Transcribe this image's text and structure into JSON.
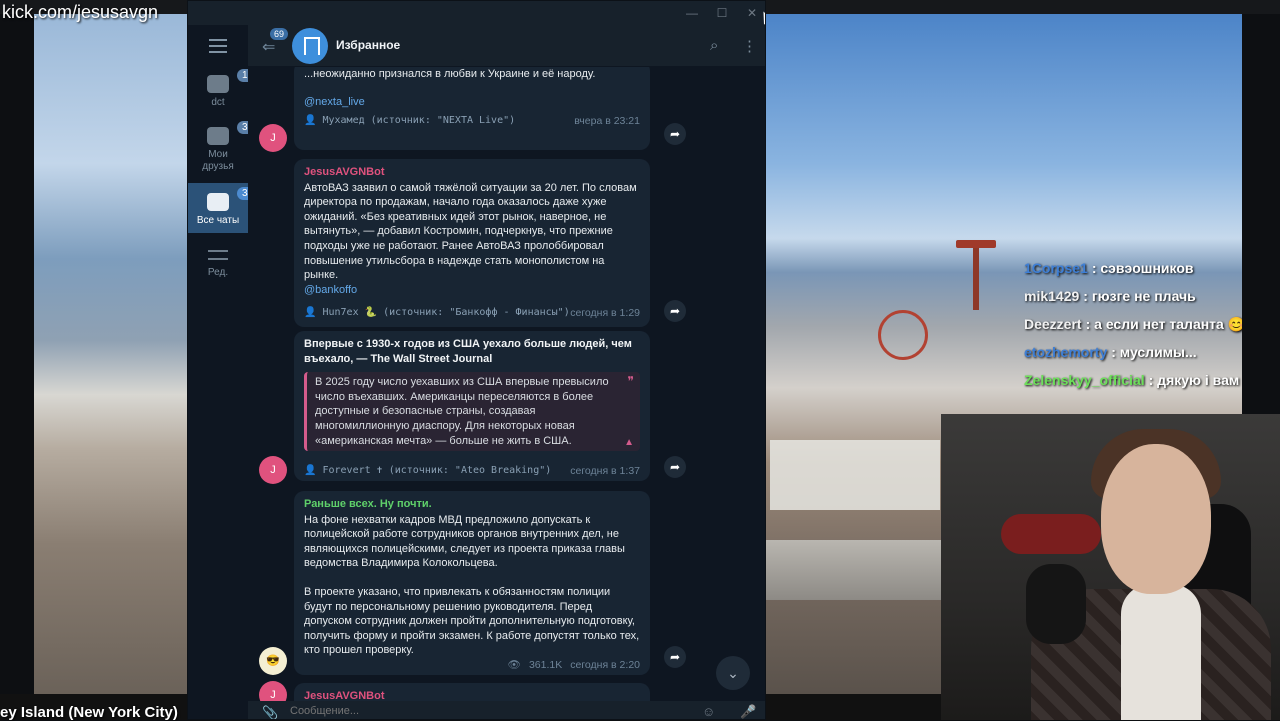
{
  "stream": {
    "url": "kick.com/jesusavgn",
    "location_caption": "ey Island (New York City)"
  },
  "stream_chat": [
    {
      "nick": "1Corpse1",
      "text": ": сэвэошников",
      "color": "#3e7fd6"
    },
    {
      "nick": "mik1429",
      "text": ": гюзге не плачь",
      "color": "#f2f2f2"
    },
    {
      "nick": "Deezzert",
      "text": ": а если нет таланта 😊",
      "color": "#f2f2f2"
    },
    {
      "nick": "etozhemorty",
      "text": ": муслимы...",
      "color": "#3e7fd6"
    },
    {
      "nick": "Zelenskyy_official",
      "text": ": дякую і вам",
      "color": "#6de05a"
    }
  ],
  "telegram": {
    "window_buttons": [
      "—",
      "☐",
      "✕"
    ],
    "folders": [
      {
        "label": "dct",
        "badge": "193",
        "icon": "folder-icon"
      },
      {
        "label": "Мои друзья",
        "badge": "31",
        "icon": "folder-icon"
      },
      {
        "label": "Все чаты",
        "badge": "344",
        "icon": "chats-icon",
        "active": true
      },
      {
        "label": "Ред.",
        "badge": "",
        "icon": "edit-folders-icon"
      }
    ],
    "header": {
      "back_badge": "69",
      "title": "Избранное"
    },
    "messages": [
      {
        "sender": "",
        "body": "...неожиданно признался в любви к Украине и её народу.",
        "link": "@nexta_live",
        "forward": "👤 Мухамед (источник: \"NEXTA Live\")",
        "time": "вчера в 23:21"
      },
      {
        "sender": "JesusAVGNBot",
        "body": "АвтоВАЗ заявил о самой тяжёлой ситуации за 20 лет. По словам директора по продажам, начало года оказалось даже хуже ожиданий. «Без креативных идей этот рынок, наверное, не вытянуть», — добавил Костромин, подчеркнув, что прежние подходы уже не работают. Ранее АвтоВАЗ пролоббировал повышение утильсбора в надежде стать монополистом на рынке.",
        "link": "@bankoffo",
        "forward": "👤 Hun7ex 🐍 (источник: \"Банкофф - Финансы\")",
        "time": "сегодня в 1:29"
      },
      {
        "title": "Впервые с 1930-х годов из США уехало больше людей, чем въехало, — The Wall Street Journal",
        "quote": "В 2025 году число уехавших из США впервые превысило число въехавших. Американцы переселяются в более доступные и безопасные страны, создавая многомиллионную диаспору. Для некоторых новая «американская мечта» — больше не жить в США.",
        "forward": "👤 Forevert ✝ (источник: \"Ateo Breaking\")",
        "time": "сегодня в 1:37"
      },
      {
        "sender": "Раньше всех. Ну почти.",
        "body1": "На фоне нехватки кадров МВД предложило допускать к полицейской работе сотрудников органов внутренних дел, не являющихся полицейскими, следует из проекта приказа главы ведомства Владимира Колокольцева.",
        "body2": "В проекте указано, что привлекать к обязанностям полиции будут по персональному решению руководителя. Перед допуском сотрудник должен пройти дополнительную подготовку, получить форму и пройти экзамен. К работе допустят только тех, кто прошел проверку.",
        "views": "361.1K",
        "time": "сегодня в 2:20"
      },
      {
        "sender": "JesusAVGNBot"
      }
    ],
    "composer": {
      "placeholder": "Сообщение..."
    },
    "colors": {
      "bg": "#0e1621",
      "bubble": "#182533",
      "accent": "#64a9e9",
      "bot_sender": "#e0527e",
      "channel_sender": "#5fd06a"
    }
  }
}
